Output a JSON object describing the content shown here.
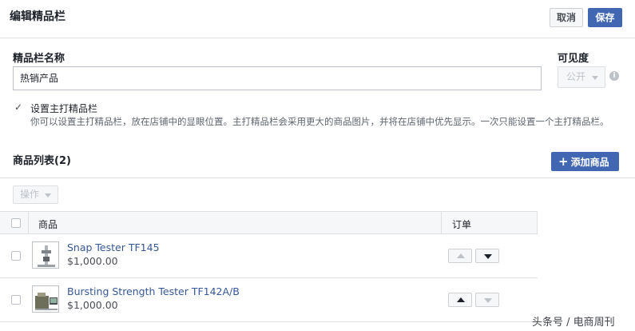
{
  "header": {
    "title": "编辑精品栏",
    "cancel_label": "取消",
    "save_label": "保存"
  },
  "form": {
    "name_label": "精品栏名称",
    "name_value": "热销产品",
    "visibility_label": "可见度",
    "visibility_value": "公开",
    "info_icon": "i",
    "featured_label": "设置主打精品栏",
    "featured_help": "你可以设置主打精品栏，放在店铺中的显眼位置。主打精品栏会采用更大的商品图片，并将在店铺中优先显示。一次只能设置一个主打精品栏。",
    "featured_checked": true
  },
  "products": {
    "section_title": "商品列表(2)",
    "add_label": "添加商品",
    "actions_label": "操作",
    "columns": {
      "product": "商品",
      "order": "订单"
    },
    "rows": [
      {
        "name": "Snap Tester TF145",
        "price": "$1,000.00",
        "icon": "snap-tester-thumbnail",
        "up_enabled": false,
        "down_enabled": true
      },
      {
        "name": "Bursting Strength Tester TF142A/B",
        "price": "$1,000.00",
        "icon": "bursting-tester-thumbnail",
        "up_enabled": true,
        "down_enabled": false
      }
    ]
  },
  "watermark": "头条号 / 电商周刊",
  "colors": {
    "accent": "#4267b2",
    "link": "#365899",
    "border": "#dddfe2"
  }
}
